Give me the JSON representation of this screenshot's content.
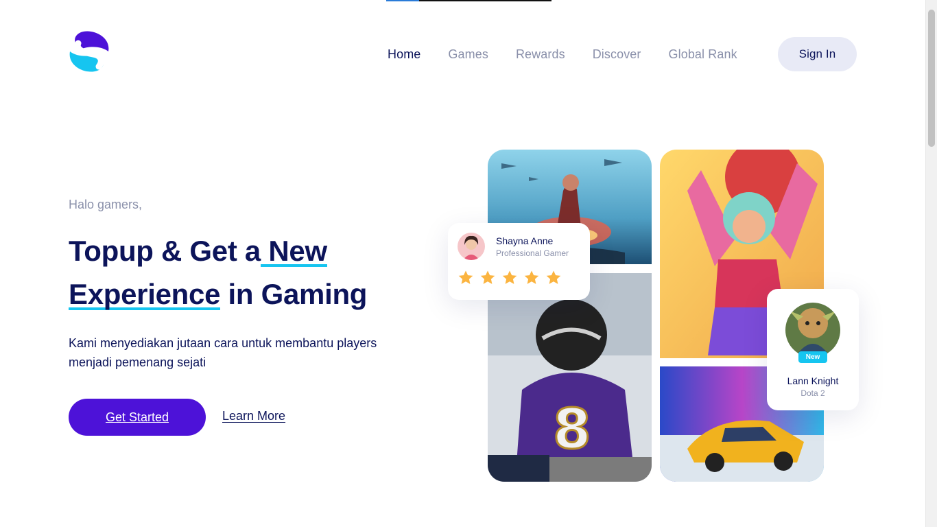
{
  "brand": {
    "accent": "#4d12d8",
    "highlight": "#16c5f0",
    "text": "#0c145a",
    "muted": "#8a90aa",
    "logo_icon": "s-logo-icon"
  },
  "nav": {
    "items": [
      {
        "label": "Home",
        "active": true
      },
      {
        "label": "Games",
        "active": false
      },
      {
        "label": "Rewards",
        "active": false
      },
      {
        "label": "Discover",
        "active": false
      },
      {
        "label": "Global Rank",
        "active": false
      }
    ],
    "sign_in": "Sign In"
  },
  "hero": {
    "greeting": "Halo gamers,",
    "headline_part1": "Topup & Get a",
    "headline_highlight1": " New",
    "headline_highlight2": "Experience",
    "headline_part2": " in Gaming",
    "description": "Kami menyediakan jutaan cara untuk membantu players menjadi pemenang sejati",
    "primary_button": "Get Started",
    "secondary_link": "Learn More"
  },
  "review_card": {
    "name": "Shayna Anne",
    "role": "Professional Gamer",
    "rating": 5,
    "star_icon": "star-icon"
  },
  "player_card": {
    "badge": "New",
    "name": "Lann Knight",
    "game": "Dota 2"
  }
}
